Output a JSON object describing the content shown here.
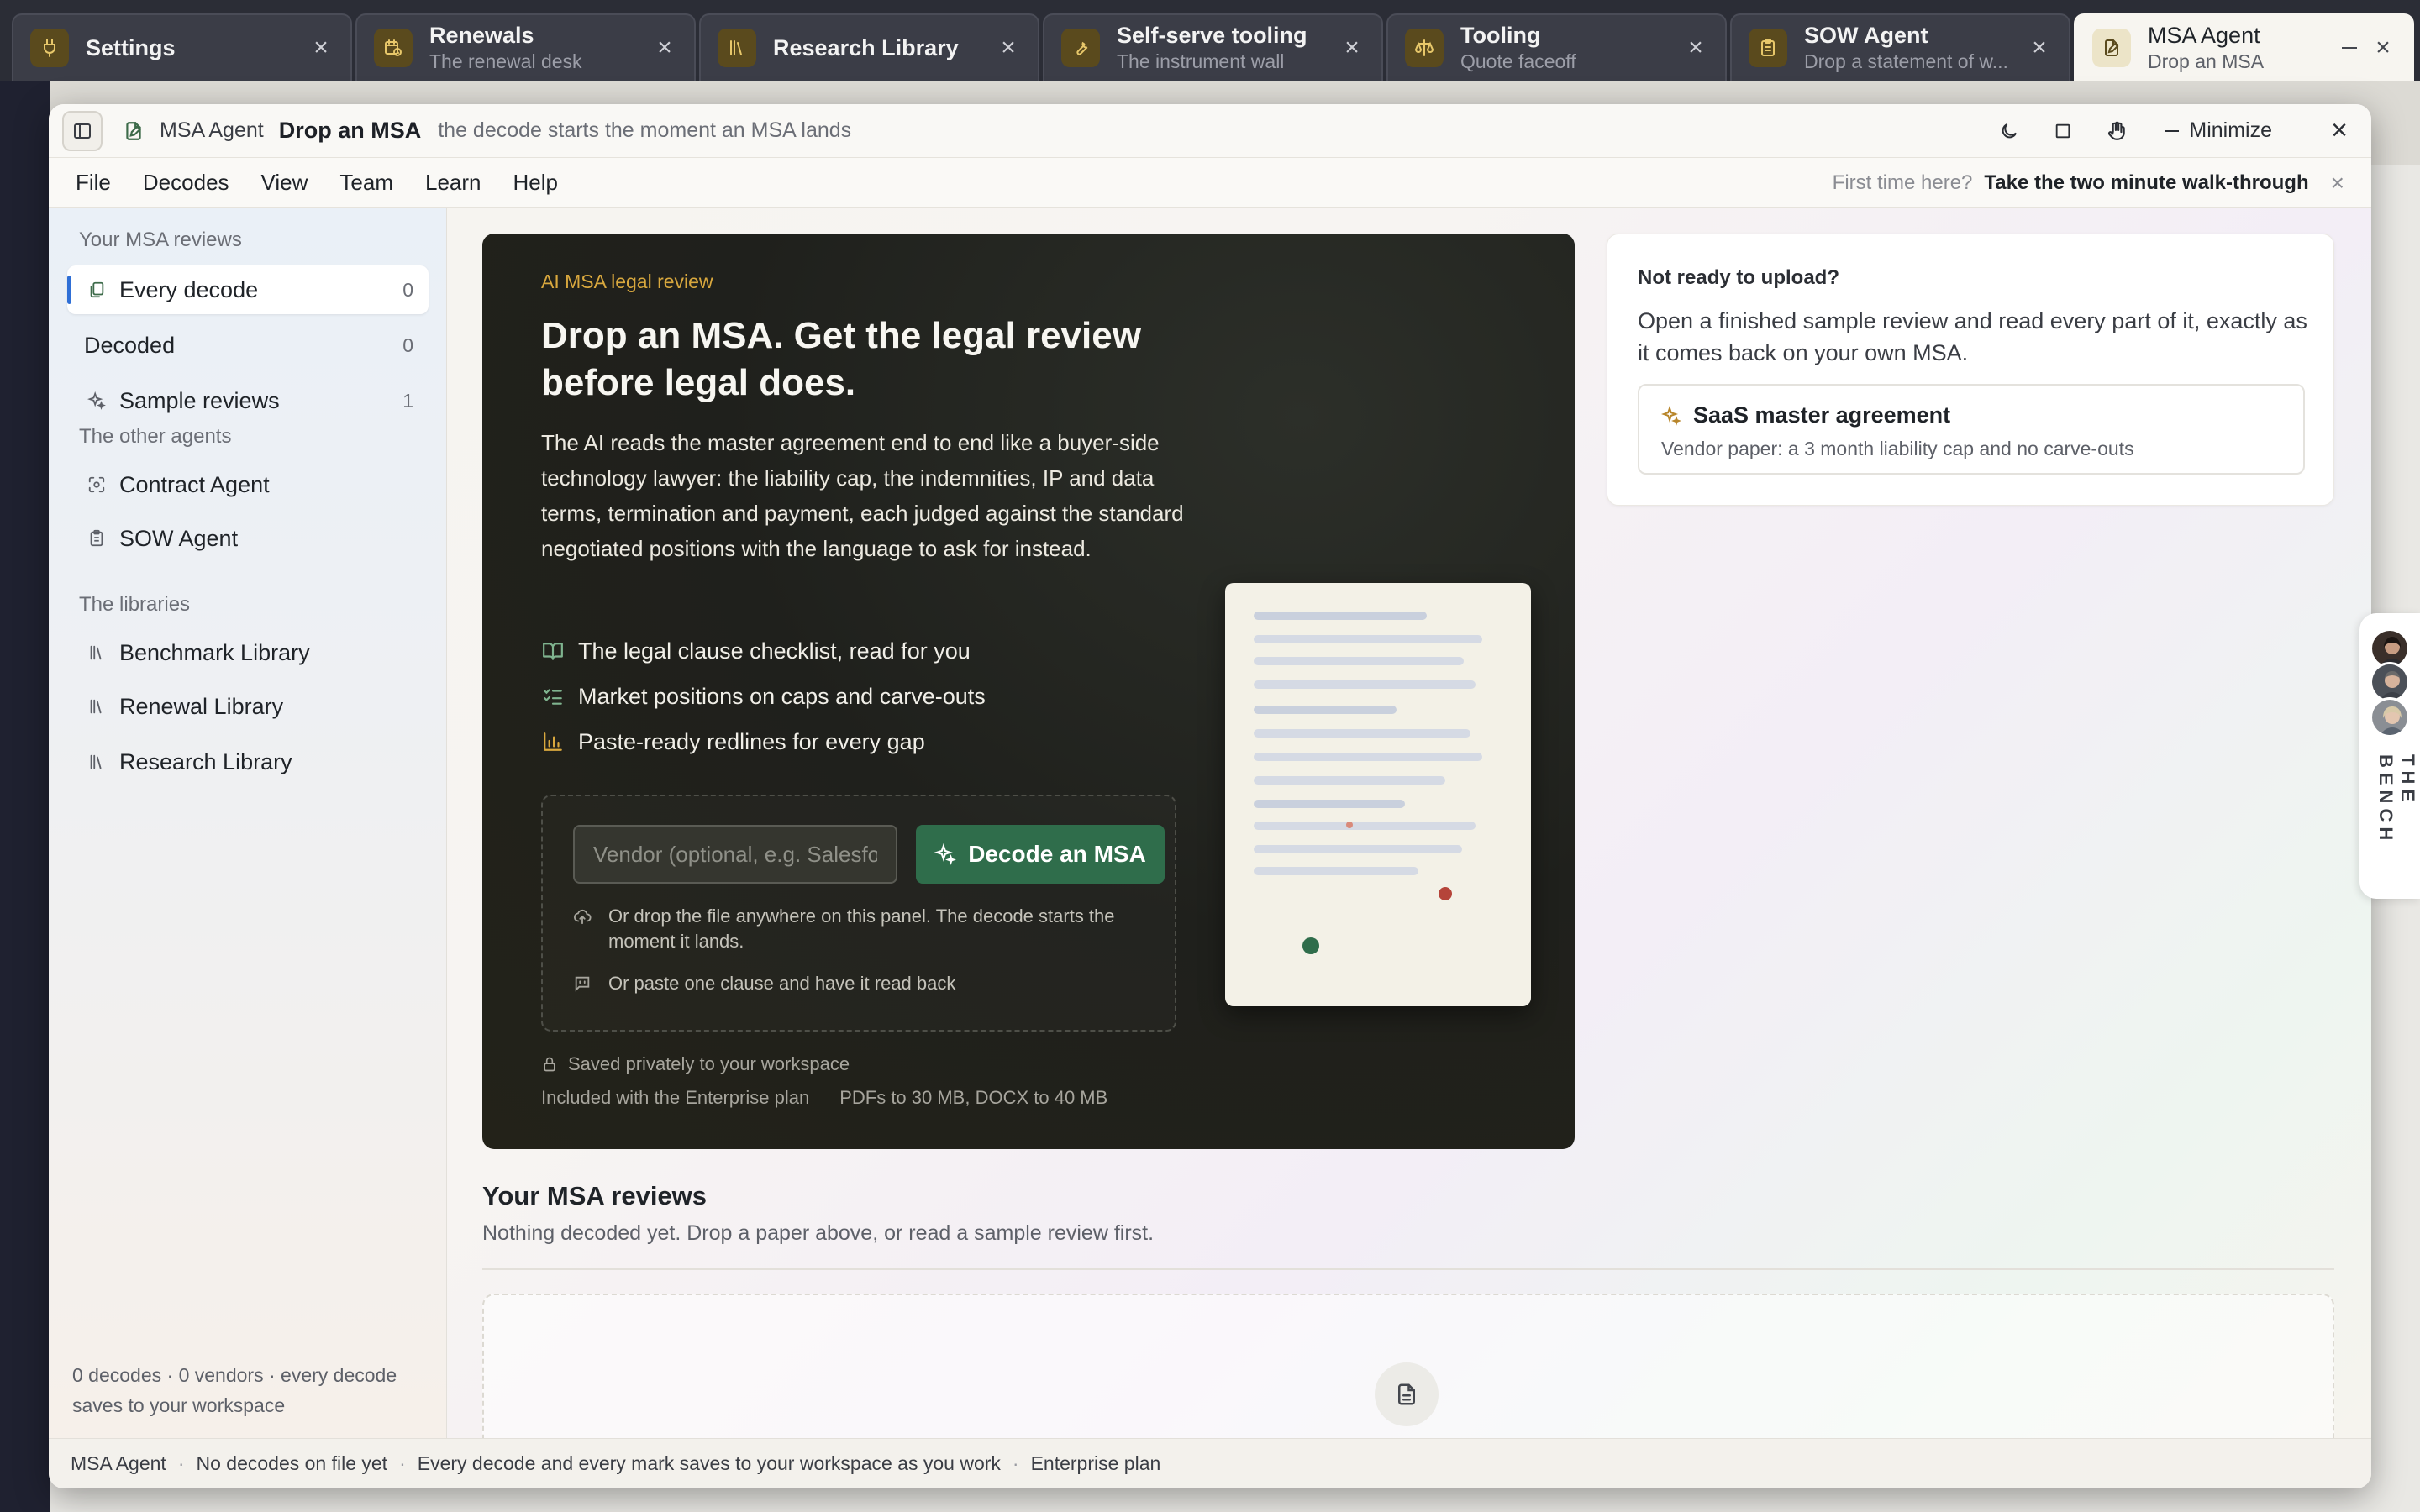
{
  "tabs": [
    {
      "title": "Settings",
      "subtitle": "",
      "icon": "plug-icon"
    },
    {
      "title": "Renewals",
      "subtitle": "The renewal desk",
      "icon": "calendar-clock-icon"
    },
    {
      "title": "Research Library",
      "subtitle": "",
      "icon": "library-icon"
    },
    {
      "title": "Self-serve tooling",
      "subtitle": "The instrument wall",
      "icon": "wrench-icon"
    },
    {
      "title": "Tooling",
      "subtitle": "Quote faceoff",
      "icon": "scale-icon"
    },
    {
      "title": "SOW Agent",
      "subtitle": "Drop a statement of w...",
      "icon": "clipboard-icon"
    },
    {
      "title": "MSA Agent",
      "subtitle": "Drop an MSA",
      "icon": "file-edit-icon"
    }
  ],
  "window": {
    "app_name": "MSA Agent",
    "title": "Drop an MSA",
    "subtitle": "the decode starts the moment an MSA lands",
    "minimize_label": "Minimize"
  },
  "menu": [
    "File",
    "Decodes",
    "View",
    "Team",
    "Learn",
    "Help"
  ],
  "walkthrough": {
    "question": "First time here?",
    "link": "Take the two minute walk-through"
  },
  "sidebar": {
    "section_reviews": "Your MSA reviews",
    "reviews": [
      {
        "label": "Every decode",
        "count": "0",
        "icon": "files-icon"
      },
      {
        "label": "Decoded",
        "count": "0",
        "icon": ""
      },
      {
        "label": "Sample reviews",
        "count": "1",
        "icon": "sparkles-icon"
      }
    ],
    "section_agents": "The other agents",
    "agents": [
      {
        "label": "Contract Agent",
        "icon": "scan-icon"
      },
      {
        "label": "SOW Agent",
        "icon": "clipboard-icon"
      }
    ],
    "section_libraries": "The libraries",
    "libraries": [
      {
        "label": "Benchmark Library",
        "icon": "library-icon"
      },
      {
        "label": "Renewal Library",
        "icon": "library-icon"
      },
      {
        "label": "Research Library",
        "icon": "library-icon"
      }
    ],
    "footer": "0 decodes · 0 vendors · every decode saves to your workspace"
  },
  "hero": {
    "eyebrow": "AI MSA legal review",
    "headline": "Drop an MSA. Get the legal review before legal does.",
    "body": "The AI reads the master agreement end to end like a buyer-side technology lawyer: the liability cap, the indemnities, IP and data terms, termination and payment, each judged against the standard negotiated positions with the language to ask for instead.",
    "bullets": [
      {
        "text": "The legal clause checklist, read for you",
        "icon": "book-open-icon"
      },
      {
        "text": "Market positions on caps and carve-outs",
        "icon": "list-checks-icon"
      },
      {
        "text": "Paste-ready redlines for every gap",
        "icon": "bar-chart-icon"
      }
    ],
    "vendor_placeholder": "Vendor (optional, e.g. Salesforce)",
    "decode_button": "Decode an MSA",
    "drop_note": "Or drop the file anywhere on this panel. The decode starts the moment it lands.",
    "paste_note": "Or paste one clause and have it read back",
    "saved_note": "Saved privately to your workspace",
    "plan_note": "Included with the Enterprise plan",
    "limits_note": "PDFs to 30 MB, DOCX to 40 MB"
  },
  "sample": {
    "title": "Not ready to upload?",
    "body": "Open a finished sample review and read every part of it, exactly as it comes back on your own MSA.",
    "item_title": "SaaS master agreement",
    "item_subtitle": "Vendor paper: a 3 month liability cap and no carve-outs"
  },
  "reviews": {
    "heading": "Your MSA reviews",
    "empty": "Nothing decoded yet. Drop a paper above, or read a sample review first."
  },
  "statusbar": {
    "app": "MSA Agent",
    "decodes": "No decodes on file yet",
    "saves": "Every decode and every mark saves to your workspace as you work",
    "plan": "Enterprise plan"
  },
  "bench": {
    "label": "THE BENCH"
  },
  "colors": {
    "accent_green": "#2f6d4b",
    "eyebrow_gold": "#d9a83e",
    "active_indicator": "#2f6fd6",
    "hero_bg": "#1f201c"
  }
}
